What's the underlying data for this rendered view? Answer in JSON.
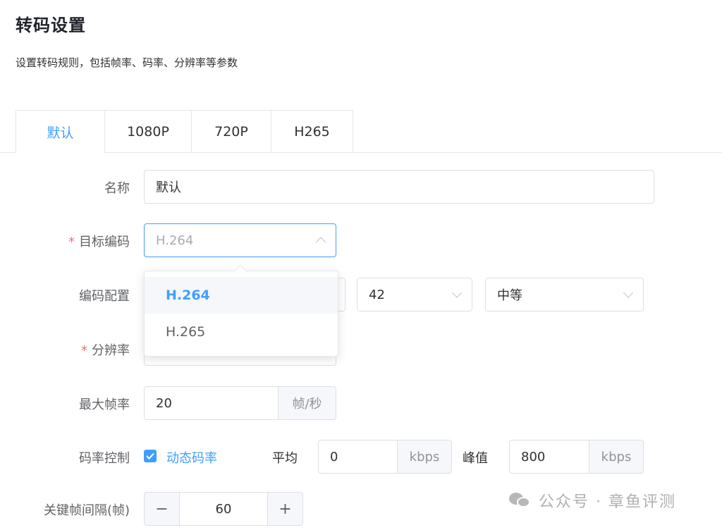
{
  "page": {
    "title": "转码设置",
    "subtitle": "设置转码规则，包括帧率、码率、分辨率等参数"
  },
  "tabs": [
    {
      "label": "默认",
      "active": true
    },
    {
      "label": "1080P",
      "active": false
    },
    {
      "label": "720P",
      "active": false
    },
    {
      "label": "H265",
      "active": false
    }
  ],
  "form": {
    "name": {
      "label": "名称",
      "value": "默认"
    },
    "target_codec": {
      "required_mark": "*",
      "label": "目标编码",
      "placeholder": "H.264",
      "options": [
        "H.264",
        "H.265"
      ],
      "selected": "H.264"
    },
    "codec_config": {
      "label": "编码配置",
      "value2": "42",
      "value3": "中等"
    },
    "resolution": {
      "required_mark": "*",
      "label": "分辨率"
    },
    "max_fps": {
      "label": "最大帧率",
      "value": "20",
      "unit": "帧/秒"
    },
    "bitrate": {
      "label": "码率控制",
      "dynamic_label": "动态码率",
      "dynamic_checked": true,
      "avg_label": "平均",
      "avg_value": "0",
      "avg_unit": "kbps",
      "peak_label": "峰值",
      "peak_value": "800",
      "peak_unit": "kbps"
    },
    "keyframe": {
      "label": "关键帧间隔(帧)",
      "value": "60",
      "minus": "−",
      "plus": "+"
    }
  },
  "watermark": {
    "text": "公众号 · 章鱼评测"
  },
  "colors": {
    "accent": "#409eff",
    "required": "#f56c6c",
    "border": "#dcdfe6"
  }
}
